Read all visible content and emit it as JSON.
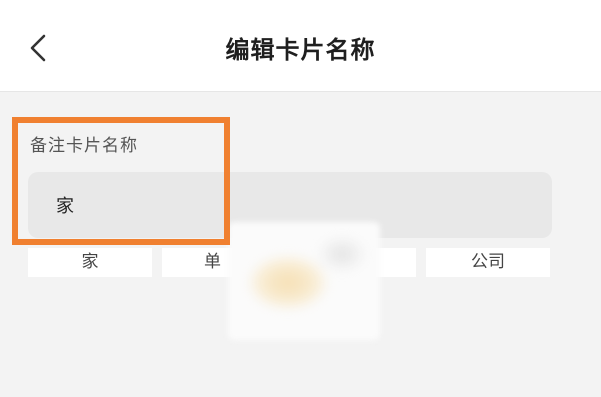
{
  "header": {
    "title": "编辑卡片名称",
    "back_icon": "chevron-left-icon"
  },
  "form": {
    "label": "备注卡片名称",
    "input_value": "家"
  },
  "chips": [
    "家",
    "单",
    "",
    "公司"
  ],
  "colors": {
    "highlight": "#f08030",
    "background": "#f3f3f3",
    "input_bg": "#e8e8e8"
  }
}
